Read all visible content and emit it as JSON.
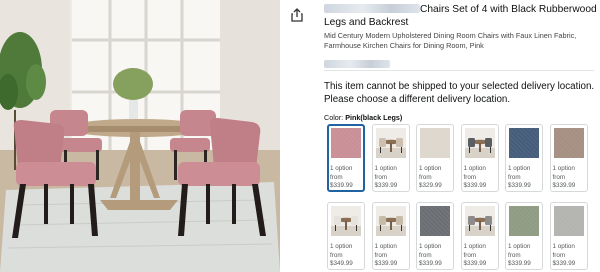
{
  "product": {
    "title_line1_suffix": "Chairs Set of 4 with Black Rubberwood",
    "title_line2": "Legs and Backrest",
    "subtitle": "Mid Century Modern Upholstered Dining Room Chairs with Faux Linen Fabric, Farmhouse Kirchen Chairs for Dining Room, Pink"
  },
  "shipping_message": {
    "line1": "This item cannot be shipped to your selected delivery location.",
    "line2": "Please choose a different delivery location."
  },
  "color": {
    "label": "Color:",
    "selected": "Pink(black Legs)"
  },
  "swatches": [
    {
      "name": "pink",
      "kind": "fabric",
      "color": "#c98f96",
      "options": "1 option",
      "from": "from",
      "price": "$339.99",
      "selected": true
    },
    {
      "name": "beige-set",
      "kind": "room",
      "color": "#cdbfae",
      "options": "1 option",
      "from": "from",
      "price": "$339.99"
    },
    {
      "name": "cream",
      "kind": "fabric",
      "color": "#ddd7cd",
      "options": "1 option",
      "from": "from",
      "price": "$329.99"
    },
    {
      "name": "dark-set",
      "kind": "room",
      "color": "#5b5f64",
      "options": "1 option",
      "from": "from",
      "price": "$339.99"
    },
    {
      "name": "navy",
      "kind": "fabric",
      "color": "#455d7a",
      "options": "1 option",
      "from": "from",
      "price": "$339.99"
    },
    {
      "name": "taupe",
      "kind": "fabric",
      "color": "#a58f82",
      "options": "1 option",
      "from": "from",
      "price": "$339.99"
    },
    {
      "name": "white-set",
      "kind": "room",
      "color": "#e6e3df",
      "options": "1 option",
      "from": "from",
      "price": "$349.99"
    },
    {
      "name": "light-set",
      "kind": "room",
      "color": "#c7bba9",
      "options": "1 option",
      "from": "from",
      "price": "$339.99"
    },
    {
      "name": "charcoal",
      "kind": "fabric",
      "color": "#6b6f73",
      "options": "1 option",
      "from": "from",
      "price": "$339.99"
    },
    {
      "name": "gray-set",
      "kind": "room",
      "color": "#8d8c8a",
      "options": "1 option",
      "from": "from",
      "price": "$339.99"
    },
    {
      "name": "sage",
      "kind": "fabric",
      "color": "#8f9b83",
      "options": "1 option",
      "from": "from",
      "price": "$339.99"
    },
    {
      "name": "silver",
      "kind": "fabric",
      "color": "#b3b3b0",
      "options": "1 option",
      "from": "from",
      "price": "$339.99"
    }
  ],
  "colors": {
    "selected_border": "#2162a1",
    "swatch_border": "#d5d9d9",
    "muted_text": "#565959"
  },
  "icons": {
    "share": "share-icon"
  }
}
